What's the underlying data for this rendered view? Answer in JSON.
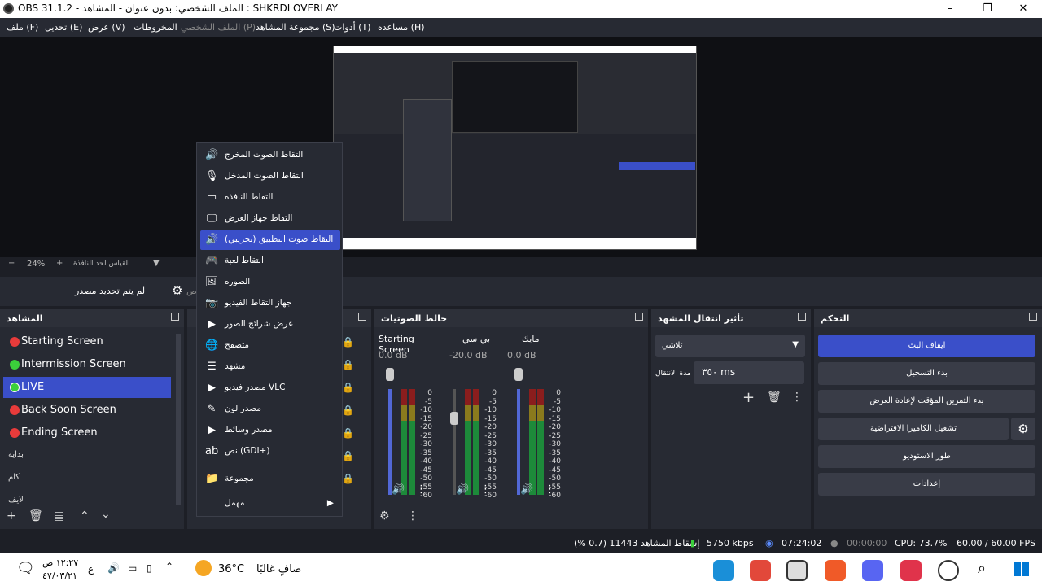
{
  "window": {
    "title": "OBS 31.1.2 - الملف الشخصي: بدون عنوان - المشاهد : SHKRDI OVERLAY",
    "min": "–",
    "max": "❐",
    "close": "✕"
  },
  "menu": [
    "ملف (F)",
    "تحديل (E)",
    "عرض (V)",
    "المخروطات",
    "الملف الشخصي (P)",
    "مجموعة المشاهد (S)",
    "أدوات (T)",
    "مساعده (H)"
  ],
  "preview": {
    "zoom": "24%",
    "zoom_label": "القياس لحد النافذة",
    "zoom_minus": "−",
    "zoom_plus": "+"
  },
  "sourcebar": {
    "no_source": "لم يتم تحديد مصدر",
    "props": "ص"
  },
  "docks": {
    "scenes": "المشاهد",
    "mixer": "خالط الصوتيات",
    "transitions": "تأثير انتقال المشهد",
    "controls": "التحكم"
  },
  "scenes": [
    {
      "name": "Starting Screen",
      "color": "#e83b3b"
    },
    {
      "name": "Intermission Screen",
      "color": "#3bcf3b"
    },
    {
      "name": "LIVE",
      "color": "#3bcf3b"
    },
    {
      "name": "Back Soon Screen",
      "color": "#e83b3b"
    },
    {
      "name": "Ending Screen",
      "color": "#e83b3b"
    }
  ],
  "scene_extra": [
    "بدايه",
    "كام",
    "لايف"
  ],
  "mixer": {
    "channels": [
      {
        "name": "Starting Screen",
        "db": "0.0 dB",
        "level": 1.0
      },
      {
        "name": "بي سي",
        "db": "-20.0 dB",
        "level": 0.6
      },
      {
        "name": "مايك",
        "db": "0.0 dB",
        "level": 1.0
      }
    ],
    "ticks": [
      "0",
      "-5",
      "-10",
      "-15",
      "-20",
      "-25",
      "-30",
      "-35",
      "-40",
      "-45",
      "-50",
      "-55",
      "-60"
    ]
  },
  "transitions": {
    "type": "تلاشي",
    "duration_label": "مدة الانتقال",
    "duration": "٣٥٠ ms"
  },
  "controls": {
    "buttons": [
      "ايقاف البث",
      "بدء التسجيل",
      "بدء التمرين المؤقت لإعادة العرض",
      "تشغيل الكاميرا الافتراضية",
      "طور الاستوديو",
      "إعدادات"
    ]
  },
  "status": {
    "dropped": "إسقاط المشاهد 11443 (0.7 %)",
    "kbps": "5750 kbps",
    "live_time": "07:24:02",
    "rec_time": "00:00:00",
    "cpu": "CPU: 73.7%",
    "fps": "60.00 / 60.00 FPS"
  },
  "taskbar": {
    "time": "١٢:٢٧ ص",
    "date": "٤٧/٠٣/٢١",
    "lang": "ع",
    "weather": "36°C",
    "weather_text": "صافٍ غالبًا"
  },
  "context_menu": [
    {
      "label": "التقاط الصوت المخرج",
      "icon": "🔊"
    },
    {
      "label": "التقاط الصوت المدخل",
      "icon": "🎙"
    },
    {
      "label": "التقاط النافذة",
      "icon": "▭"
    },
    {
      "label": "التقاط جهاز العرض",
      "icon": "🖵"
    },
    {
      "label": "التقاط صوت التطبيق (تجريبي)",
      "icon": "🔊"
    },
    {
      "label": "التقاط لعبة",
      "icon": "🎮"
    },
    {
      "label": "الصوره",
      "icon": "🖼"
    },
    {
      "label": "جهاز التقاط الفيديو",
      "icon": "📷"
    },
    {
      "label": "عرض شرائح الصور",
      "icon": "▶"
    },
    {
      "label": "متصفح",
      "icon": "🌐"
    },
    {
      "label": "مشهد",
      "icon": "☰"
    },
    {
      "label": "مصدر فيديو VLC",
      "icon": "▶"
    },
    {
      "label": "مصدر لون",
      "icon": "✎"
    },
    {
      "label": "مصدر وسائط",
      "icon": "▶"
    },
    {
      "label": "نص (GDI+)",
      "icon": "ab"
    },
    {
      "label": "مجموعة",
      "icon": "📁"
    },
    {
      "label": "مهمل",
      "icon": ""
    }
  ],
  "context_arrow": "▶"
}
